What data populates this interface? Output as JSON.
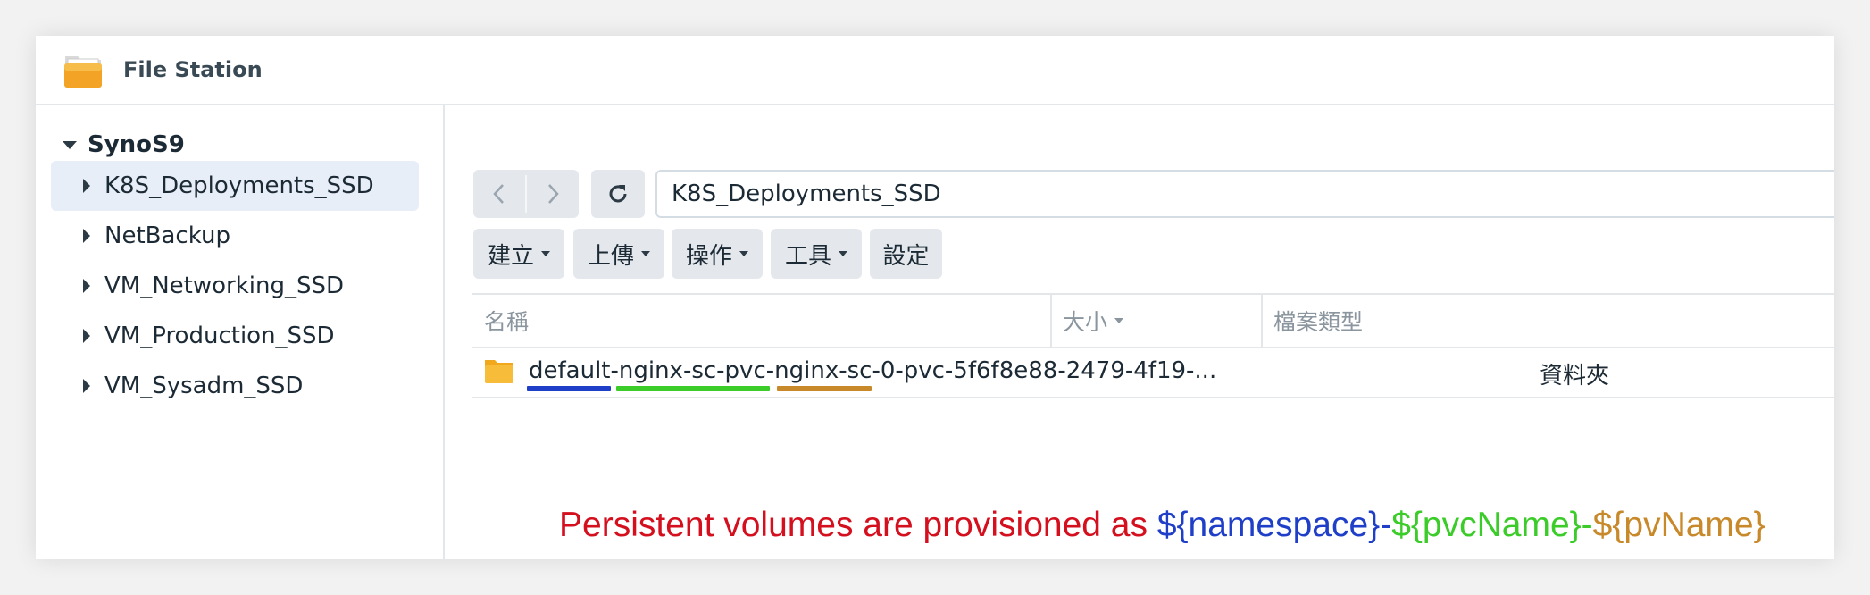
{
  "app": {
    "title": "File Station",
    "icon": "folder-app-icon"
  },
  "sidebar": {
    "root": "SynoS9",
    "items": [
      {
        "label": "K8S_Deployments_SSD",
        "selected": true
      },
      {
        "label": "NetBackup",
        "selected": false
      },
      {
        "label": "VM_Networking_SSD",
        "selected": false
      },
      {
        "label": "VM_Production_SSD",
        "selected": false
      },
      {
        "label": "VM_Sysadm_SSD",
        "selected": false
      }
    ]
  },
  "toolbar": {
    "path": "K8S_Deployments_SSD",
    "buttons": {
      "create": "建立",
      "upload": "上傳",
      "action": "操作",
      "tools": "工具",
      "settings": "設定"
    }
  },
  "table": {
    "columns": {
      "name": "名稱",
      "size": "大小",
      "type": "檔案類型"
    },
    "rows": [
      {
        "name_parts": {
          "namespace": "default",
          "sep1": "-",
          "pvc": "nginx-sc-pvc",
          "sep2": "-",
          "pv": "nginx-sc",
          "rest": "-0-pvc-5f6f8e88-2479-4f19-..."
        },
        "size": "",
        "type": "資料夾"
      }
    ]
  },
  "annotation": {
    "prefix": "Persistent volumes are provisioned as ",
    "namespace": "${namespace}",
    "sep1": "-",
    "pvcName": "${pvcName}",
    "sep2": "-",
    "pvName": "${pvName}"
  },
  "colors": {
    "annotation_text": "#d40f1e",
    "namespace": "#1f3fc8",
    "pvcName": "#3ccc2a",
    "pvName": "#c8892a",
    "selected_bg": "#e7eef8",
    "button_bg": "#e4e8ec"
  }
}
